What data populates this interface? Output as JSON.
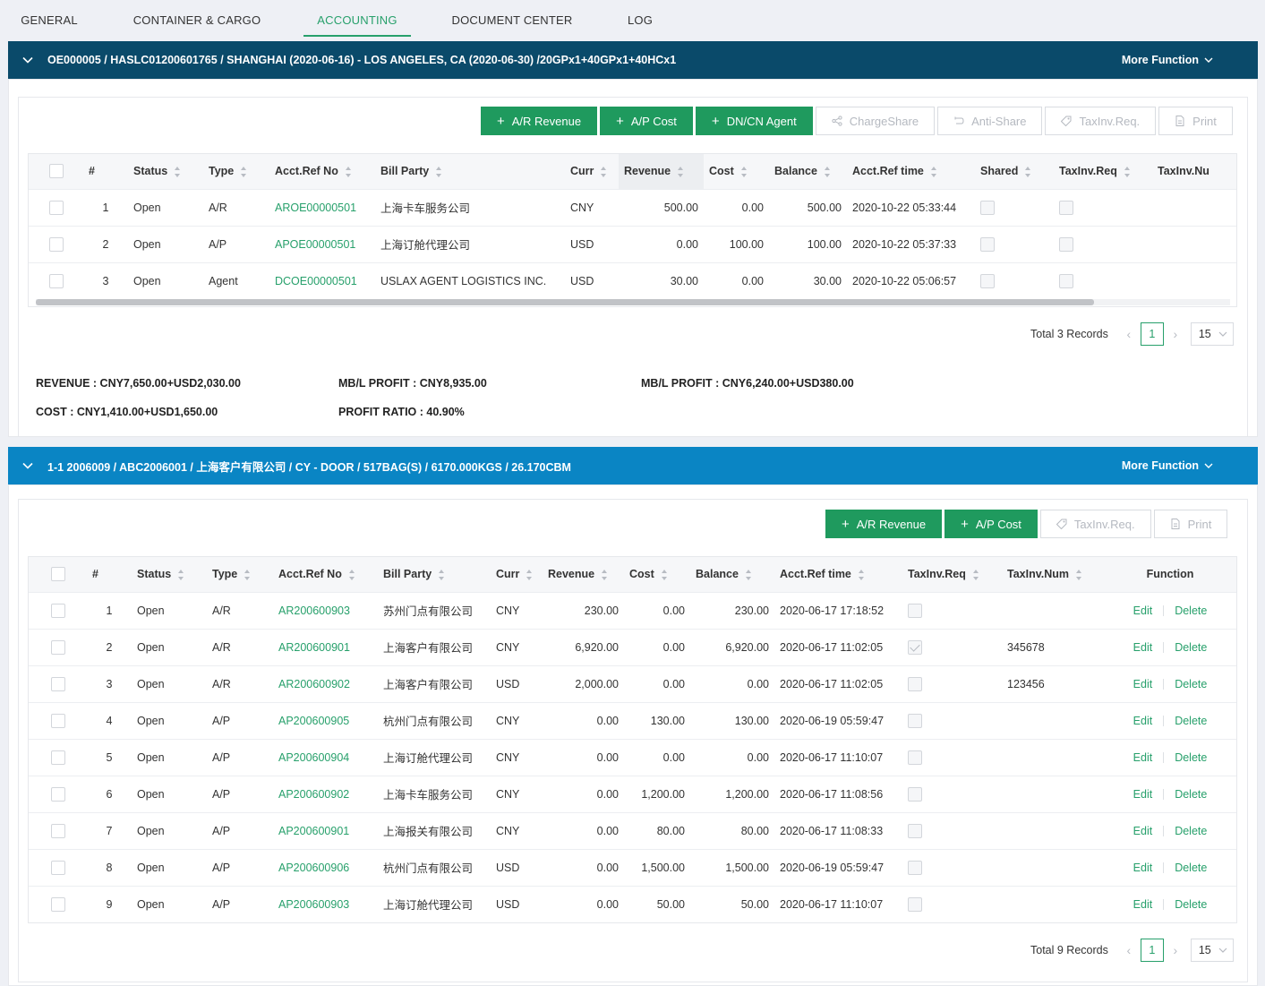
{
  "tabs": [
    {
      "label": "GENERAL",
      "active": false
    },
    {
      "label": "CONTAINER & CARGO",
      "active": false
    },
    {
      "label": "ACCOUNTING",
      "active": true
    },
    {
      "label": "DOCUMENT CENTER",
      "active": false
    },
    {
      "label": "LOG",
      "active": false
    }
  ],
  "section1": {
    "title": "OE000005 / HASLC01200601765 / SHANGHAI (2020-06-16) - LOS ANGELES, CA (2020-06-30) /20GPx1+40GPx1+40HCx1",
    "more_label": "More Function",
    "buttons": [
      {
        "label": "A/R Revenue",
        "icon": "plus-icon",
        "enabled": true
      },
      {
        "label": "A/P Cost",
        "icon": "plus-icon",
        "enabled": true
      },
      {
        "label": "DN/CN Agent",
        "icon": "plus-icon",
        "enabled": true
      },
      {
        "label": "ChargeShare",
        "icon": "share-icon",
        "enabled": false
      },
      {
        "label": "Anti-Share",
        "icon": "undo-icon",
        "enabled": false
      },
      {
        "label": "TaxInv.Req.",
        "icon": "tag-icon",
        "enabled": false
      },
      {
        "label": "Print",
        "icon": "file-icon",
        "enabled": false
      }
    ],
    "columns": [
      "#",
      "Status",
      "Type",
      "Acct.Ref No",
      "Bill Party",
      "Curr",
      "Revenue",
      "Cost",
      "Balance",
      "Acct.Ref time",
      "Shared",
      "TaxInv.Req",
      "TaxInv.Nu"
    ],
    "rows": [
      {
        "no": "1",
        "status": "Open",
        "type": "A/R",
        "ref": "AROE00000501",
        "party": "上海卡车服务公司",
        "curr": "CNY",
        "revenue": "500.00",
        "cost": "0.00",
        "balance": "500.00",
        "time": "2020-10-22 05:33:44",
        "shared": false,
        "taxreq": false
      },
      {
        "no": "2",
        "status": "Open",
        "type": "A/P",
        "ref": "APOE00000501",
        "party": "上海订舱代理公司",
        "curr": "USD",
        "revenue": "0.00",
        "cost": "100.00",
        "balance": "100.00",
        "time": "2020-10-22 05:37:33",
        "shared": false,
        "taxreq": false
      },
      {
        "no": "3",
        "status": "Open",
        "type": "Agent",
        "ref": "DCOE00000501",
        "party": "USLAX AGENT LOGISTICS INC.",
        "curr": "USD",
        "revenue": "30.00",
        "cost": "0.00",
        "balance": "30.00",
        "time": "2020-10-22 05:06:57",
        "shared": false,
        "taxreq": false
      }
    ],
    "pager": {
      "total": "Total 3 Records",
      "page": "1",
      "size": "15"
    },
    "summary": {
      "revenue": "REVENUE : CNY7,650.00+USD2,030.00",
      "cost": "COST : CNY1,410.00+USD1,650.00",
      "mbl_profit1": "MB/L PROFIT : CNY8,935.00",
      "profit_ratio": "PROFIT RATIO : 40.90%",
      "mbl_profit2": "MB/L PROFIT : CNY6,240.00+USD380.00"
    }
  },
  "section2": {
    "title": "1-1 2006009 / ABC2006001 / 上海客户有限公司 / CY - DOOR / 517BAG(S) / 6170.000KGS / 26.170CBM",
    "more_label": "More Function",
    "buttons": [
      {
        "label": "A/R Revenue",
        "icon": "plus-icon",
        "enabled": true
      },
      {
        "label": "A/P Cost",
        "icon": "plus-icon",
        "enabled": true
      },
      {
        "label": "TaxInv.Req.",
        "icon": "tag-icon",
        "enabled": false
      },
      {
        "label": "Print",
        "icon": "file-icon",
        "enabled": false
      }
    ],
    "columns": [
      "#",
      "Status",
      "Type",
      "Acct.Ref No",
      "Bill Party",
      "Curr",
      "Revenue",
      "Cost",
      "Balance",
      "Acct.Ref time",
      "TaxInv.Req",
      "TaxInv.Num",
      "Function"
    ],
    "edit_label": "Edit",
    "delete_label": "Delete",
    "rows": [
      {
        "no": "1",
        "status": "Open",
        "type": "A/R",
        "ref": "AR200600903",
        "party": "苏州门点有限公司",
        "curr": "CNY",
        "revenue": "230.00",
        "cost": "0.00",
        "balance": "230.00",
        "time": "2020-06-17 17:18:52",
        "taxreq": false,
        "taxnum": ""
      },
      {
        "no": "2",
        "status": "Open",
        "type": "A/R",
        "ref": "AR200600901",
        "party": "上海客户有限公司",
        "curr": "CNY",
        "revenue": "6,920.00",
        "cost": "0.00",
        "balance": "6,920.00",
        "time": "2020-06-17 11:02:05",
        "taxreq": true,
        "taxnum": "345678"
      },
      {
        "no": "3",
        "status": "Open",
        "type": "A/R",
        "ref": "AR200600902",
        "party": "上海客户有限公司",
        "curr": "USD",
        "revenue": "2,000.00",
        "cost": "0.00",
        "balance": "0.00",
        "time": "2020-06-17 11:02:05",
        "taxreq": false,
        "taxnum": "123456"
      },
      {
        "no": "4",
        "status": "Open",
        "type": "A/P",
        "ref": "AP200600905",
        "party": "杭州门点有限公司",
        "curr": "CNY",
        "revenue": "0.00",
        "cost": "130.00",
        "balance": "130.00",
        "time": "2020-06-19 05:59:47",
        "taxreq": false,
        "taxnum": ""
      },
      {
        "no": "5",
        "status": "Open",
        "type": "A/P",
        "ref": "AP200600904",
        "party": "上海订舱代理公司",
        "curr": "CNY",
        "revenue": "0.00",
        "cost": "0.00",
        "balance": "0.00",
        "time": "2020-06-17 11:10:07",
        "taxreq": false,
        "taxnum": ""
      },
      {
        "no": "6",
        "status": "Open",
        "type": "A/P",
        "ref": "AP200600902",
        "party": "上海卡车服务公司",
        "curr": "CNY",
        "revenue": "0.00",
        "cost": "1,200.00",
        "balance": "1,200.00",
        "time": "2020-06-17 11:08:56",
        "taxreq": false,
        "taxnum": ""
      },
      {
        "no": "7",
        "status": "Open",
        "type": "A/P",
        "ref": "AP200600901",
        "party": "上海报关有限公司",
        "curr": "CNY",
        "revenue": "0.00",
        "cost": "80.00",
        "balance": "80.00",
        "time": "2020-06-17 11:08:33",
        "taxreq": false,
        "taxnum": ""
      },
      {
        "no": "8",
        "status": "Open",
        "type": "A/P",
        "ref": "AP200600906",
        "party": "杭州门点有限公司",
        "curr": "USD",
        "revenue": "0.00",
        "cost": "1,500.00",
        "balance": "1,500.00",
        "time": "2020-06-19 05:59:47",
        "taxreq": false,
        "taxnum": ""
      },
      {
        "no": "9",
        "status": "Open",
        "type": "A/P",
        "ref": "AP200600903",
        "party": "上海订舱代理公司",
        "curr": "USD",
        "revenue": "0.00",
        "cost": "50.00",
        "balance": "50.00",
        "time": "2020-06-17 11:10:07",
        "taxreq": false,
        "taxnum": ""
      }
    ],
    "pager": {
      "total": "Total 9 Records",
      "page": "1",
      "size": "15"
    }
  }
}
